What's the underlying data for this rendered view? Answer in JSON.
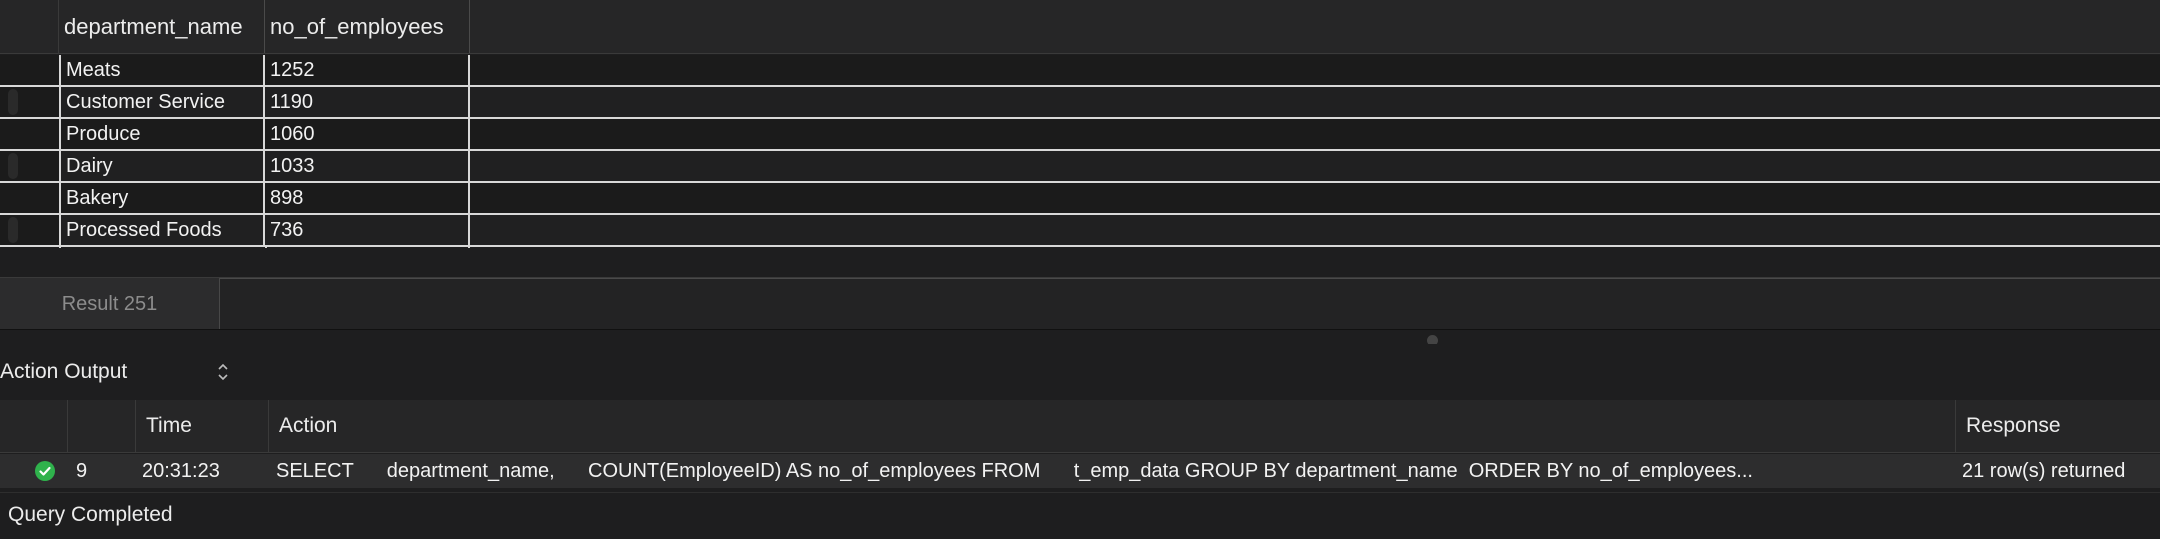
{
  "result_grid": {
    "columns": [
      "department_name",
      "no_of_employees"
    ],
    "rows": [
      [
        "Meats",
        "1252"
      ],
      [
        "Customer Service",
        "1190"
      ],
      [
        "Produce",
        "1060"
      ],
      [
        "Dairy",
        "1033"
      ],
      [
        "Bakery",
        "898"
      ],
      [
        "Processed Foods",
        "736"
      ]
    ]
  },
  "result_tab": {
    "label": "Result 251"
  },
  "action_output": {
    "selector_label": "Action Output",
    "columns": {
      "time": "Time",
      "action": "Action",
      "response": "Response"
    },
    "rows": [
      {
        "status": "success",
        "number": "9",
        "time": "20:31:23",
        "action": "SELECT      department_name,      COUNT(EmployeeID) AS no_of_employees FROM      t_emp_data GROUP BY department_name  ORDER BY no_of_employees...",
        "response": "21 row(s) returned"
      }
    ]
  },
  "status_bar": {
    "text": "Query Completed"
  },
  "colors": {
    "success": "#2fb24c",
    "background": "#1e1e1f",
    "header": "#262627"
  },
  "icons": {
    "status": "check-circle-icon",
    "selector": "chevron-up-down-icon"
  }
}
